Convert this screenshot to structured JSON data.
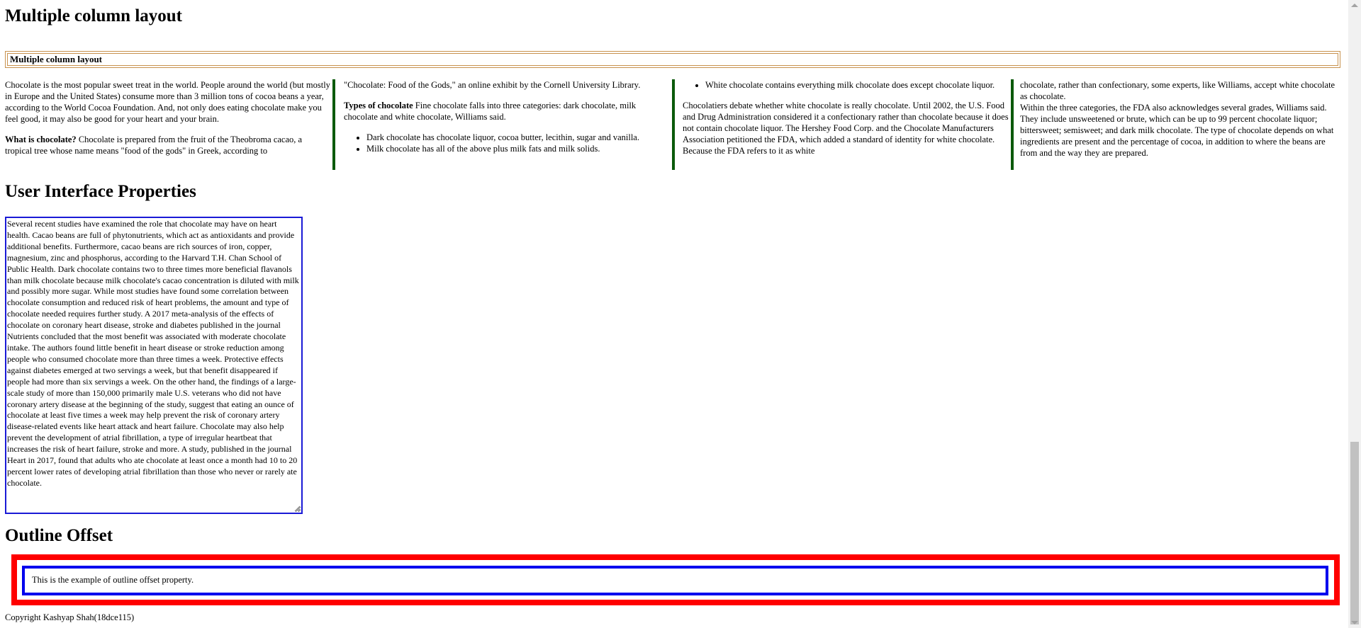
{
  "heading_multi": "Multiple column layout",
  "fieldbox_label": "Multiple column layout",
  "col1": {
    "p1": "Chocolate is the most popular sweet treat in the world. People around the world (but mostly in Europe and the United States) consume more than 3 million tons of cocoa beans a year, according to the World Cocoa Foundation. And, not only does eating chocolate make you feel good, it may also be good for your heart and your brain.",
    "p2_bold": "What is chocolate?",
    "p2": " Chocolate is prepared from the fruit of the Theobroma cacao, a tropical tree whose name means \"food of the gods\" in Greek, according to"
  },
  "col2": {
    "p1": "\"Chocolate: Food of the Gods,\" an online exhibit by the Cornell University Library.",
    "p2_bold": "Types of chocolate",
    "p2": " Fine chocolate falls into three categories: dark chocolate, milk chocolate and white chocolate, Williams said.",
    "li1": "Dark chocolate has chocolate liquor, cocoa butter, lecithin, sugar and vanilla.",
    "li2": "Milk chocolate has all of the above plus milk fats and milk solids."
  },
  "col3": {
    "li1": "White chocolate contains everything milk chocolate does except chocolate liquor.",
    "p1": "Chocolatiers debate whether white chocolate is really chocolate. Until 2002, the U.S. Food and Drug Administration considered it a confectionary rather than chocolate because it does not contain chocolate liquor. The Hershey Food Corp. and the Chocolate Manufacturers Association petitioned the FDA, which added a standard of identity for white chocolate. Because the FDA refers to it as white"
  },
  "col4": {
    "p1": "chocolate, rather than confectionary, some experts, like Williams, accept white chocolate as chocolate.",
    "p2": "Within the three categories, the FDA also acknowledges several grades, Williams said. They include unsweetened or brute, which can be up to 99 percent chocolate liquor; bittersweet; semisweet; and dark milk chocolate. The type of chocolate depends on what ingredients are present and the percentage of cocoa, in addition to where the beans are from and the way they are prepared."
  },
  "heading_ui": "User Interface Properties",
  "textarea_text": "Several recent studies have examined the role that chocolate may have on heart health. Cacao beans are full of phytonutrients, which act as antioxidants and provide additional benefits. Furthermore, cacao beans are rich sources of iron, copper, magnesium, zinc and phosphorus, according to the Harvard T.H. Chan School of Public Health. Dark chocolate contains two to three times more beneficial flavanols than milk chocolate because milk chocolate's cacao concentration is diluted with milk and possibly more sugar. While most studies have found some correlation between chocolate consumption and reduced risk of heart problems, the amount and type of chocolate needed requires further study. A 2017 meta-analysis of the effects of chocolate on coronary heart disease, stroke and diabetes published in the journal Nutrients concluded that the most benefit was associated with moderate chocolate intake. The authors found little benefit in heart disease or stroke reduction among people who consumed chocolate more than three times a week. Protective effects against diabetes emerged at two servings a week, but that benefit disappeared if people had more than six servings a week. On the other hand, the findings of a large-scale study of more than 150,000 primarily male U.S. veterans who did not have coronary artery disease at the beginning of the study, suggest that eating an ounce of chocolate at least five times a week may help prevent the risk of coronary artery disease-related events like heart attack and heart failure. Chocolate may also help prevent the development of atrial fibrillation, a type of irregular heartbeat that increases the risk of heart failure, stroke and more. A study, published in the journal Heart in 2017, found that adults who ate chocolate at least once a month had 10 to 20 percent lower rates of developing atrial fibrillation than those who never or rarely ate chocolate.",
  "heading_outline": "Outline Offset",
  "outline_text": "This is the example of outline offset property.",
  "footer": "Copyright Kashyap Shah(18dce115)",
  "colors": {
    "rule": "#0b5a0b",
    "outline": "#ff0000",
    "border": "#0000ee",
    "field": "#c8924e"
  }
}
